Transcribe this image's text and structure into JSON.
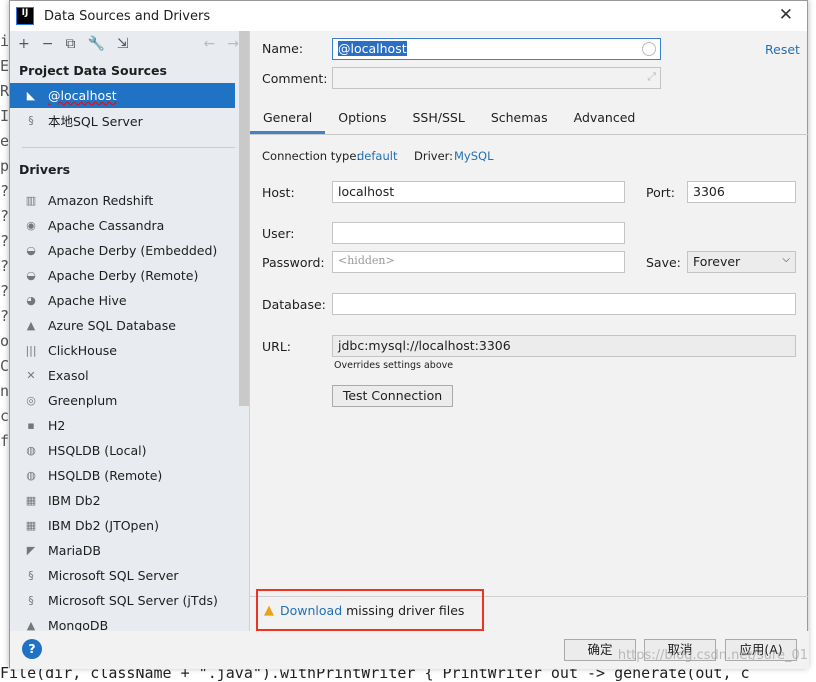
{
  "editor": {
    "bottom_line": "File(dir, className + \".java\").withPrintWriter { PrintWriter out -> generate(out, c",
    "gutter": [
      "i",
      "E",
      "R",
      "I",
      "e",
      "p",
      "?",
      "?",
      "?",
      "?",
      "?",
      "?",
      "o",
      "C",
      "n",
      "c",
      "f"
    ]
  },
  "dialog": {
    "title": "Data Sources and Drivers",
    "close": "✕"
  },
  "toolbar": {
    "add": "+",
    "remove": "−",
    "copy": "⧉",
    "settings": "🔧",
    "import": "⇲",
    "back": "←",
    "forward": "→"
  },
  "sidebar": {
    "project_header": "Project Data Sources",
    "project_items": [
      {
        "label": "@localhost",
        "selected": true
      },
      {
        "label": "本地SQL Server"
      }
    ],
    "drivers_header": "Drivers",
    "drivers": [
      "Amazon Redshift",
      "Apache Cassandra",
      "Apache Derby (Embedded)",
      "Apache Derby (Remote)",
      "Apache Hive",
      "Azure SQL Database",
      "ClickHouse",
      "Exasol",
      "Greenplum",
      "H2",
      "HSQLDB (Local)",
      "HSQLDB (Remote)",
      "IBM Db2",
      "IBM Db2 (JTOpen)",
      "MariaDB",
      "Microsoft SQL Server",
      "Microsoft SQL Server (jTds)",
      "MongoDB"
    ]
  },
  "form": {
    "name_label": "Name:",
    "name_value": "@localhost",
    "reset": "Reset",
    "comment_label": "Comment:",
    "comment_value": "",
    "tabs": [
      {
        "label": "General",
        "active": true
      },
      {
        "label": "Options"
      },
      {
        "label": "SSH/SSL"
      },
      {
        "label": "Schemas"
      },
      {
        "label": "Advanced"
      }
    ],
    "conn_type_label": "Connection type:",
    "conn_type_value": "default",
    "driver_label": "Driver:",
    "driver_value": "MySQL",
    "host_label": "Host:",
    "host_value": "localhost",
    "port_label": "Port:",
    "port_value": "3306",
    "user_label": "User:",
    "user_value": "",
    "password_label": "Password:",
    "password_placeholder": "<hidden>",
    "save_label": "Save:",
    "save_value": "Forever",
    "database_label": "Database:",
    "database_value": "",
    "url_label": "URL:",
    "url_value": "jdbc:mysql://localhost:3306",
    "url_hint": "Overrides settings above",
    "test_button": "Test Connection"
  },
  "warning": {
    "link": "Download",
    "text": "missing driver files",
    "color": "#e8a317"
  },
  "footer": {
    "help": "?",
    "ok": "确定",
    "cancel": "取消",
    "apply": "应用(A)"
  },
  "watermark": "https://blog.csdn.net/sure_01"
}
